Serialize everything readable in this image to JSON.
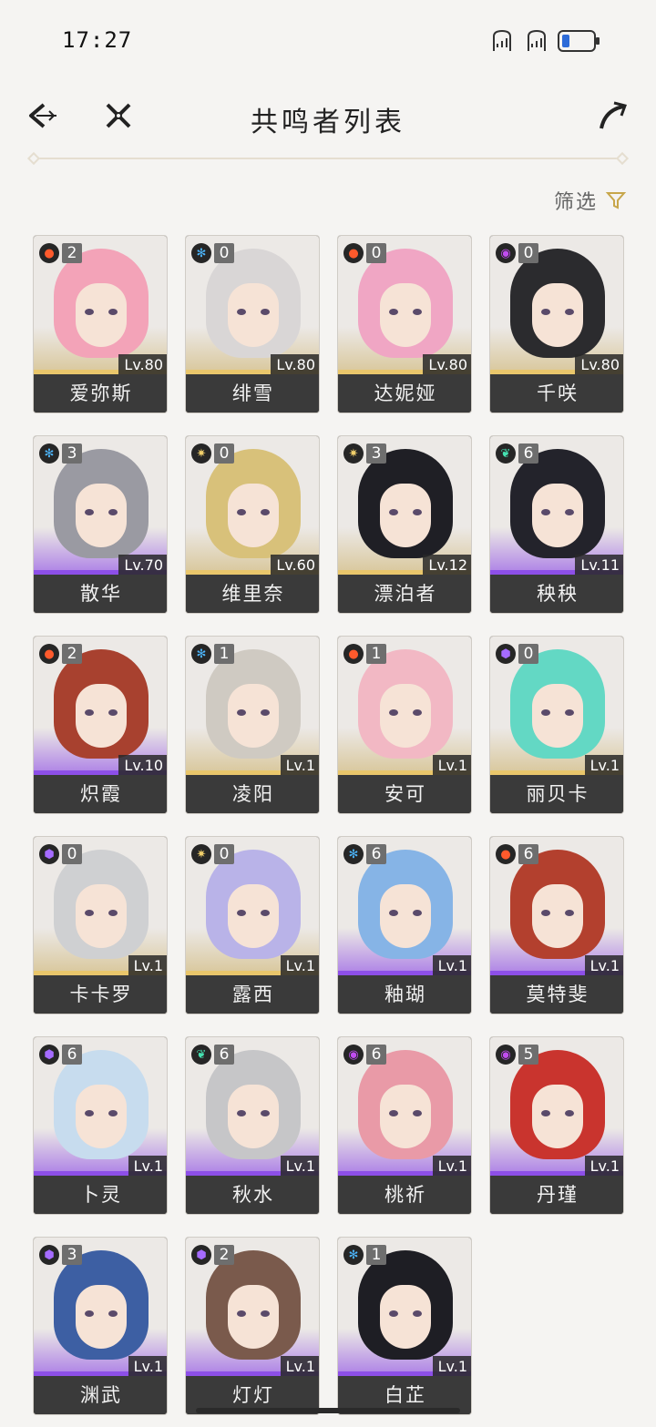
{
  "status_bar": {
    "time": "17:27"
  },
  "header": {
    "title": "共鸣者列表"
  },
  "filter": {
    "label": "筛选"
  },
  "elements": {
    "fusion": {
      "color": "#ff5a2c",
      "icon": "fire-icon"
    },
    "glacio": {
      "color": "#4db7ff",
      "icon": "snowflake-icon"
    },
    "spectro": {
      "color": "#f2d06b",
      "icon": "sun-icon"
    },
    "aero": {
      "color": "#45e0b0",
      "icon": "wind-icon"
    },
    "havoc": {
      "color": "#c04cf0",
      "icon": "vortex-icon"
    },
    "electro": {
      "color": "#a56bff",
      "icon": "lightning-icon"
    }
  },
  "characters": [
    {
      "name": "爱弥斯",
      "constellation": "2",
      "level": "Lv.80",
      "element": "fusion",
      "rarity": "gold",
      "hair": "#f3a3b8"
    },
    {
      "name": "绯雪",
      "constellation": "0",
      "level": "Lv.80",
      "element": "glacio",
      "rarity": "gold",
      "hair": "#d9d6d6"
    },
    {
      "name": "达妮娅",
      "constellation": "0",
      "level": "Lv.80",
      "element": "fusion",
      "rarity": "gold",
      "hair": "#f0a6c4"
    },
    {
      "name": "千咲",
      "constellation": "0",
      "level": "Lv.80",
      "element": "havoc",
      "rarity": "gold",
      "hair": "#2b2b2e"
    },
    {
      "name": "散华",
      "constellation": "3",
      "level": "Lv.70",
      "element": "glacio",
      "rarity": "purple",
      "hair": "#9a9aa2"
    },
    {
      "name": "维里奈",
      "constellation": "0",
      "level": "Lv.60",
      "element": "spectro",
      "rarity": "gold",
      "hair": "#d8c17a"
    },
    {
      "name": "漂泊者",
      "constellation": "3",
      "level": "Lv.12",
      "element": "spectro",
      "rarity": "gold",
      "hair": "#1f1f25"
    },
    {
      "name": "秧秧",
      "constellation": "6",
      "level": "Lv.11",
      "element": "aero",
      "rarity": "purple",
      "hair": "#23232b"
    },
    {
      "name": "炽霞",
      "constellation": "2",
      "level": "Lv.10",
      "element": "fusion",
      "rarity": "purple",
      "hair": "#a8412f"
    },
    {
      "name": "凌阳",
      "constellation": "1",
      "level": "Lv.1",
      "element": "glacio",
      "rarity": "gold",
      "hair": "#cfcac2"
    },
    {
      "name": "安可",
      "constellation": "1",
      "level": "Lv.1",
      "element": "fusion",
      "rarity": "gold",
      "hair": "#f2b8c4"
    },
    {
      "name": "丽贝卡",
      "constellation": "0",
      "level": "Lv.1",
      "element": "electro",
      "rarity": "gold",
      "hair": "#63d8c4"
    },
    {
      "name": "卡卡罗",
      "constellation": "0",
      "level": "Lv.1",
      "element": "electro",
      "rarity": "gold",
      "hair": "#cfd0d2"
    },
    {
      "name": "露西",
      "constellation": "0",
      "level": "Lv.1",
      "element": "spectro",
      "rarity": "gold",
      "hair": "#b9b3e8"
    },
    {
      "name": "釉瑚",
      "constellation": "6",
      "level": "Lv.1",
      "element": "glacio",
      "rarity": "purple",
      "hair": "#86b4e6"
    },
    {
      "name": "莫特斐",
      "constellation": "6",
      "level": "Lv.1",
      "element": "fusion",
      "rarity": "purple",
      "hair": "#b3402e"
    },
    {
      "name": "卜灵",
      "constellation": "6",
      "level": "Lv.1",
      "element": "electro",
      "rarity": "purple",
      "hair": "#c7dcee"
    },
    {
      "name": "秋水",
      "constellation": "6",
      "level": "Lv.1",
      "element": "aero",
      "rarity": "purple",
      "hair": "#c6c6c8"
    },
    {
      "name": "桃祈",
      "constellation": "6",
      "level": "Lv.1",
      "element": "havoc",
      "rarity": "purple",
      "hair": "#e99aa7"
    },
    {
      "name": "丹瑾",
      "constellation": "5",
      "level": "Lv.1",
      "element": "havoc",
      "rarity": "purple",
      "hair": "#c9342e"
    },
    {
      "name": "渊武",
      "constellation": "3",
      "level": "Lv.1",
      "element": "electro",
      "rarity": "purple",
      "hair": "#3d5fa3"
    },
    {
      "name": "灯灯",
      "constellation": "2",
      "level": "Lv.1",
      "element": "electro",
      "rarity": "purple",
      "hair": "#7a5a4c"
    },
    {
      "name": "白芷",
      "constellation": "1",
      "level": "Lv.1",
      "element": "glacio",
      "rarity": "purple",
      "hair": "#1e1e24"
    }
  ]
}
